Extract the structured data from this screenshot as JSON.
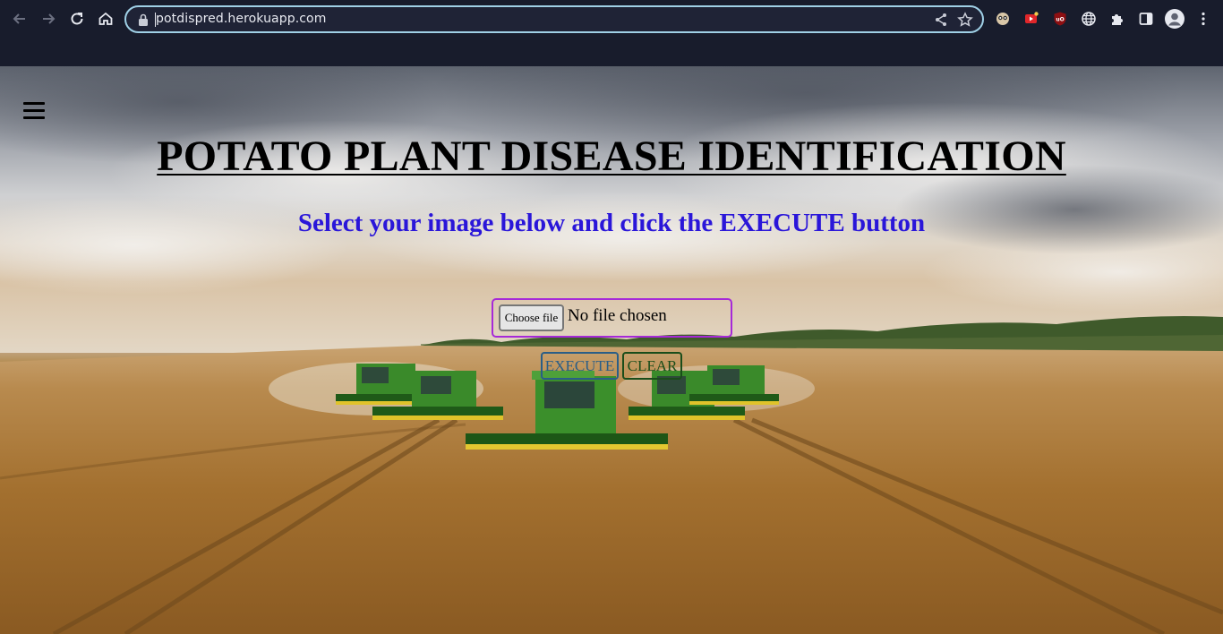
{
  "browser": {
    "url": "potdispred.herokuapp.com",
    "back_icon": "arrow-left-icon",
    "forward_icon": "arrow-right-icon",
    "reload_icon": "reload-icon",
    "home_icon": "home-icon",
    "extensions": [
      "face-extension-icon",
      "video-extension-icon",
      "ublock-icon",
      "globe-icon",
      "puzzle-icon",
      "sidebar-icon",
      "profile-icon",
      "kebab-menu-icon"
    ]
  },
  "page": {
    "title": "POTATO PLANT DISEASE IDENTIFICATION",
    "subtitle": "Select your image below and click the EXECUTE button",
    "file_input": {
      "button_label": "Choose file",
      "status": "No file chosen"
    },
    "execute_label": "EXECUTE",
    "clear_label": "CLEAR"
  },
  "colors": {
    "title": "#000000",
    "subtitle": "#2a16d9",
    "file_border": "#a629d8",
    "execute": "#2a5e87",
    "clear": "#1a4d1a"
  }
}
